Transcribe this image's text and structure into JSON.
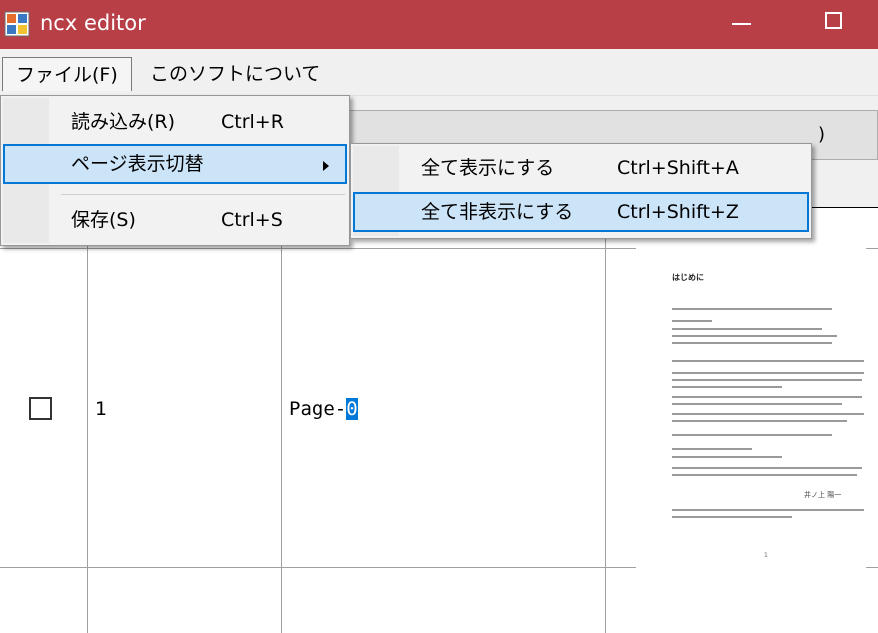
{
  "window": {
    "title": "ncx editor",
    "minimize_icon": "minimize-icon",
    "maximize_icon": "maximize-icon"
  },
  "menubar": {
    "file": "ファイル(F)",
    "about": "このソフトについて"
  },
  "file_menu": {
    "items": [
      {
        "label": "読み込み(R)",
        "shortcut": "Ctrl+R"
      },
      {
        "label": "ページ表示切替",
        "shortcut": ""
      },
      {
        "label": "保存(S)",
        "shortcut": "Ctrl+S"
      }
    ]
  },
  "page_view_submenu": {
    "items": [
      {
        "label": "全て表示にする",
        "shortcut": "Ctrl+Shift+A"
      },
      {
        "label": "全て非表示にする",
        "shortcut": "Ctrl+Shift+Z"
      }
    ]
  },
  "toolbar": {
    "button_tail": ")"
  },
  "grid": {
    "rows": [
      {
        "checked": false,
        "number": "1",
        "title_prefix": "Page-",
        "title_selected": "0"
      }
    ]
  },
  "thumbnail": {
    "heading": "はじめに",
    "signature": "井ノ上 陽一",
    "page_number": "1"
  },
  "colors": {
    "titlebar": "#b93f47",
    "highlight": "#cce4f7",
    "highlight_border": "#0078d7",
    "text_selection": "#0078d7"
  }
}
